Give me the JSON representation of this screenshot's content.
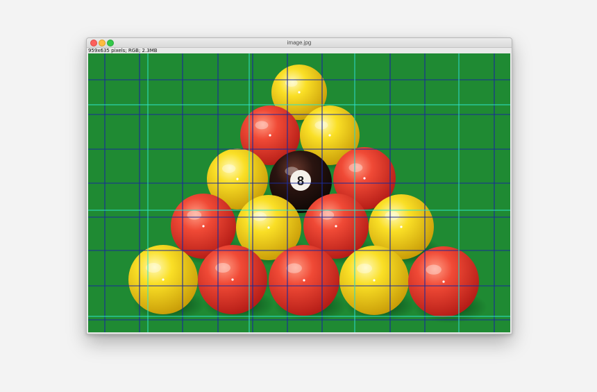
{
  "window": {
    "title": "image.jpg",
    "info": "959x635 pixels; RGB; 2.3MB"
  },
  "colors": {
    "felt": "#1f8a33",
    "red_ball": "#e8362b",
    "yellow_ball": "#f7d818",
    "black_ball": "#1a0f0c",
    "grid_dark": "#1a2a9a",
    "grid_cyan": "#2ee6c8"
  },
  "image": {
    "eight_ball_label": "8",
    "balls": [
      {
        "row": 1,
        "color": "yellow"
      },
      {
        "row": 2,
        "color": "red"
      },
      {
        "row": 2,
        "color": "yellow"
      },
      {
        "row": 3,
        "color": "yellow"
      },
      {
        "row": 3,
        "color": "black"
      },
      {
        "row": 3,
        "color": "red"
      },
      {
        "row": 4,
        "color": "red"
      },
      {
        "row": 4,
        "color": "yellow"
      },
      {
        "row": 4,
        "color": "red"
      },
      {
        "row": 4,
        "color": "yellow"
      },
      {
        "row": 5,
        "color": "yellow"
      },
      {
        "row": 5,
        "color": "red"
      },
      {
        "row": 5,
        "color": "red"
      },
      {
        "row": 5,
        "color": "yellow"
      },
      {
        "row": 5,
        "color": "red"
      }
    ]
  }
}
